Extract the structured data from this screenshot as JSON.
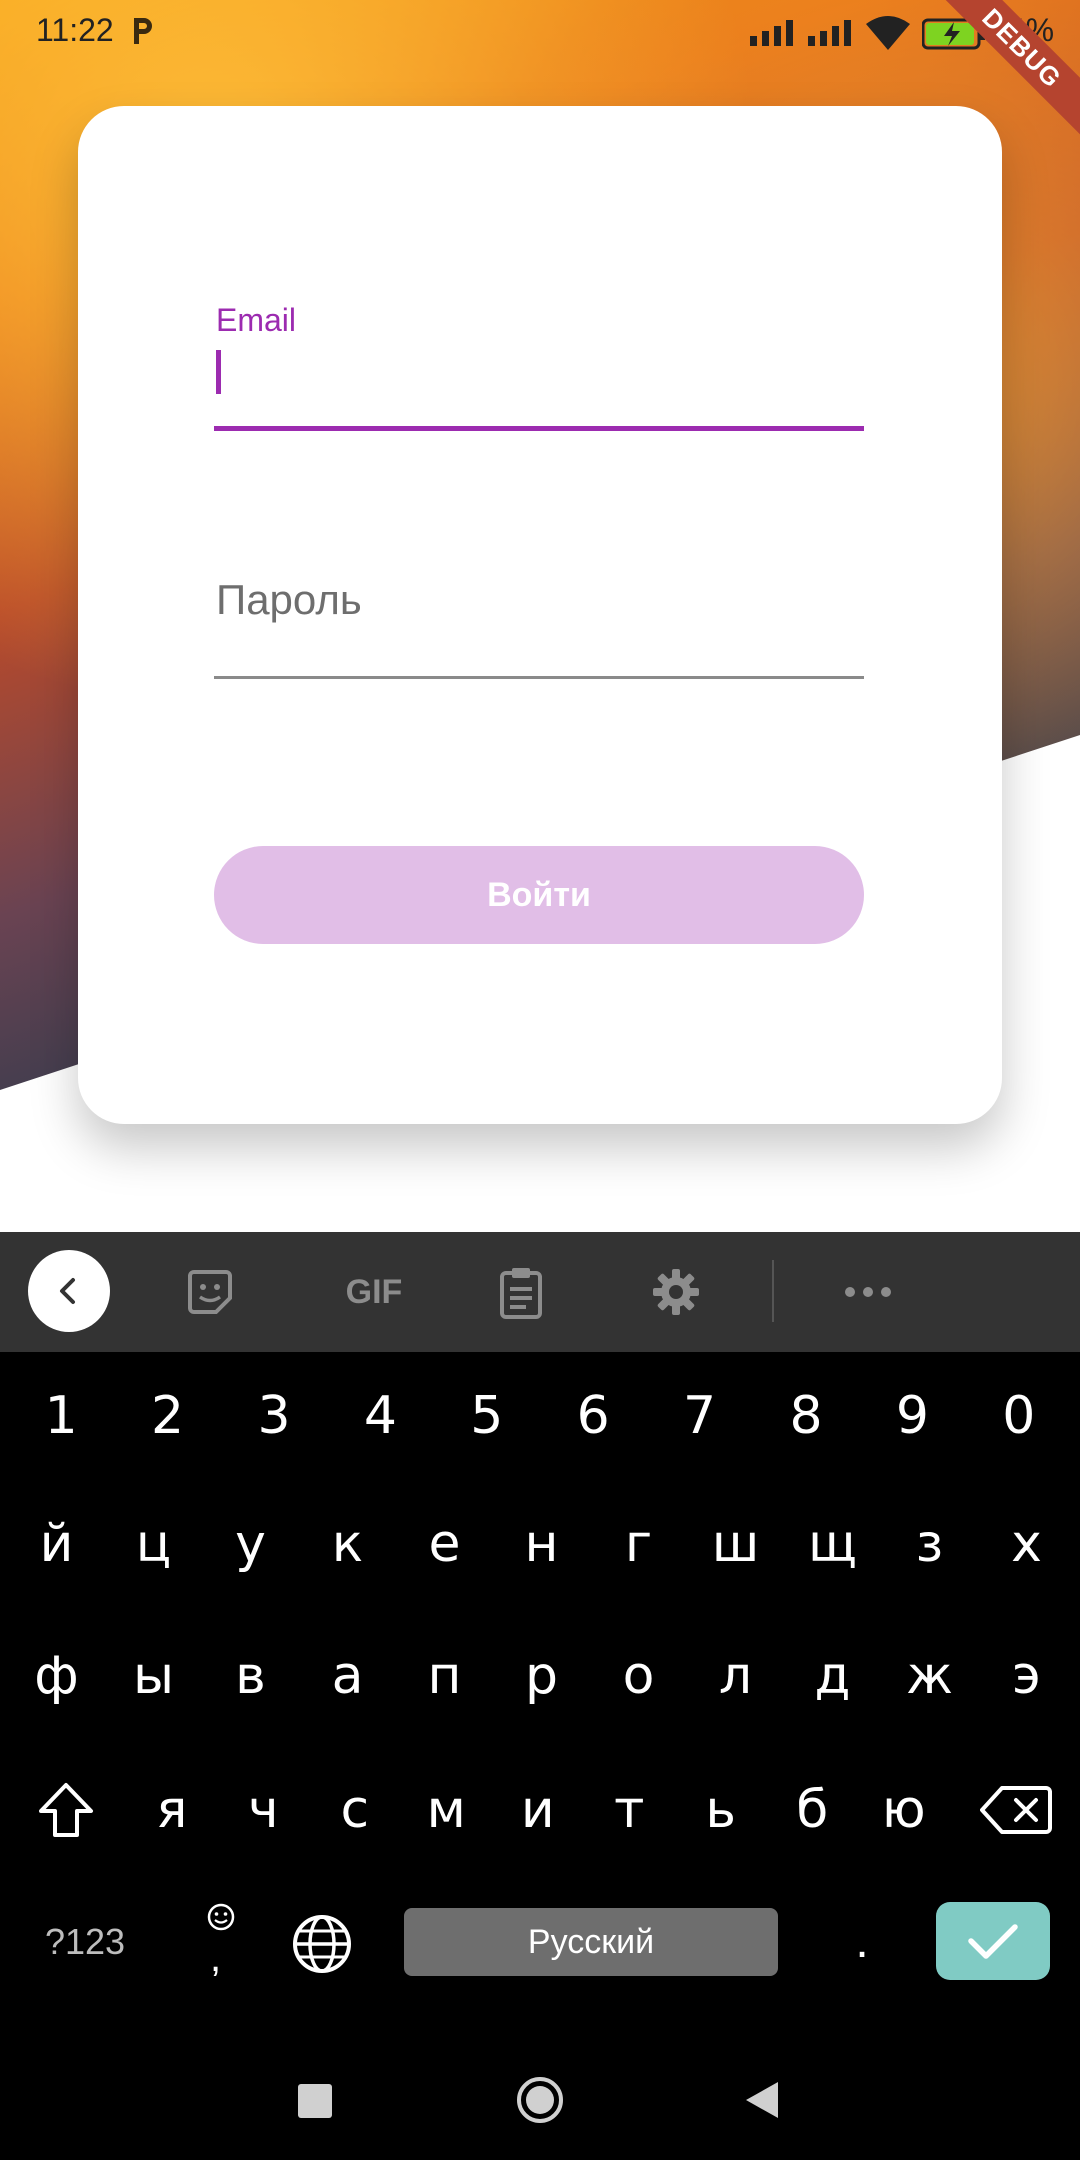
{
  "status_bar": {
    "time": "11:22",
    "battery_percent": "94%",
    "debug_label": "DEBUG",
    "icons": [
      "p-app-icon",
      "signal-icon",
      "signal-icon",
      "wifi-icon",
      "battery-charging-icon"
    ]
  },
  "login": {
    "email_label": "Email",
    "email_value": "",
    "password_label": "Пароль",
    "password_value": "",
    "submit_label": "Войти",
    "accent_color": "#9c2bb0",
    "button_color": "#e1bee7"
  },
  "keyboard": {
    "toolbar": {
      "items": [
        "chevron-left-icon",
        "sticker-icon",
        "gif",
        "clipboard-icon",
        "gear-icon",
        "more-icon"
      ],
      "gif_label": "GIF"
    },
    "number_row": [
      "1",
      "2",
      "3",
      "4",
      "5",
      "6",
      "7",
      "8",
      "9",
      "0"
    ],
    "row1": [
      "й",
      "ц",
      "у",
      "к",
      "е",
      "н",
      "г",
      "ш",
      "щ",
      "з",
      "х"
    ],
    "row2": [
      "ф",
      "ы",
      "в",
      "а",
      "п",
      "р",
      "о",
      "л",
      "д",
      "ж",
      "э"
    ],
    "row3": [
      "я",
      "ч",
      "с",
      "м",
      "и",
      "т",
      "ь",
      "б",
      "ю"
    ],
    "symbols_label": "?123",
    "comma_label": ",",
    "space_label": "Русский",
    "period_label": ".",
    "enter_color": "#80cbc4"
  },
  "nav_bar": {
    "icons": [
      "recents-icon",
      "home-icon",
      "back-icon"
    ]
  }
}
